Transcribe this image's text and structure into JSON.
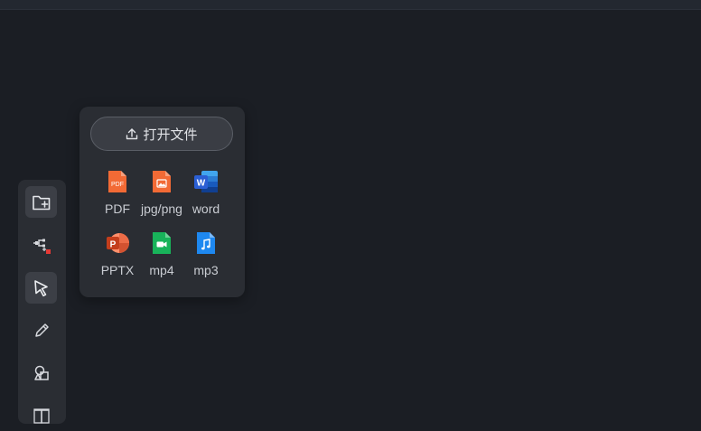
{
  "open_menu": {
    "open_file_label": "打开文件",
    "file_types": [
      {
        "label": "PDF",
        "icon": "pdf-icon",
        "icon_text": "PDF",
        "color": "#f26a35"
      },
      {
        "label": "jpg/png",
        "icon": "image-file-icon",
        "color": "#f26a35"
      },
      {
        "label": "word",
        "icon": "word-icon",
        "icon_text": "W",
        "color": "#2b5fd4"
      },
      {
        "label": "PPTX",
        "icon": "powerpoint-icon",
        "icon_text": "P",
        "color": "#e0572e"
      },
      {
        "label": "mp4",
        "icon": "video-file-icon",
        "color": "#18b35a"
      },
      {
        "label": "mp3",
        "icon": "audio-file-icon",
        "color": "#1e88f0"
      }
    ]
  },
  "toolbar": {
    "tools": [
      {
        "icon": "add-folder-icon",
        "active": true
      },
      {
        "icon": "mindmap-icon",
        "active": false,
        "badge_color": "#e53935"
      },
      {
        "icon": "select-cursor-icon",
        "active": true
      },
      {
        "icon": "pen-icon",
        "active": false
      },
      {
        "icon": "shapes-icon",
        "active": false
      },
      {
        "icon": "text-icon",
        "active": false
      }
    ]
  },
  "colors": {
    "background": "#1b1e24",
    "panel": "#2a2d33",
    "active_tool": "#3c3f46",
    "text": "#c9ccd2"
  }
}
